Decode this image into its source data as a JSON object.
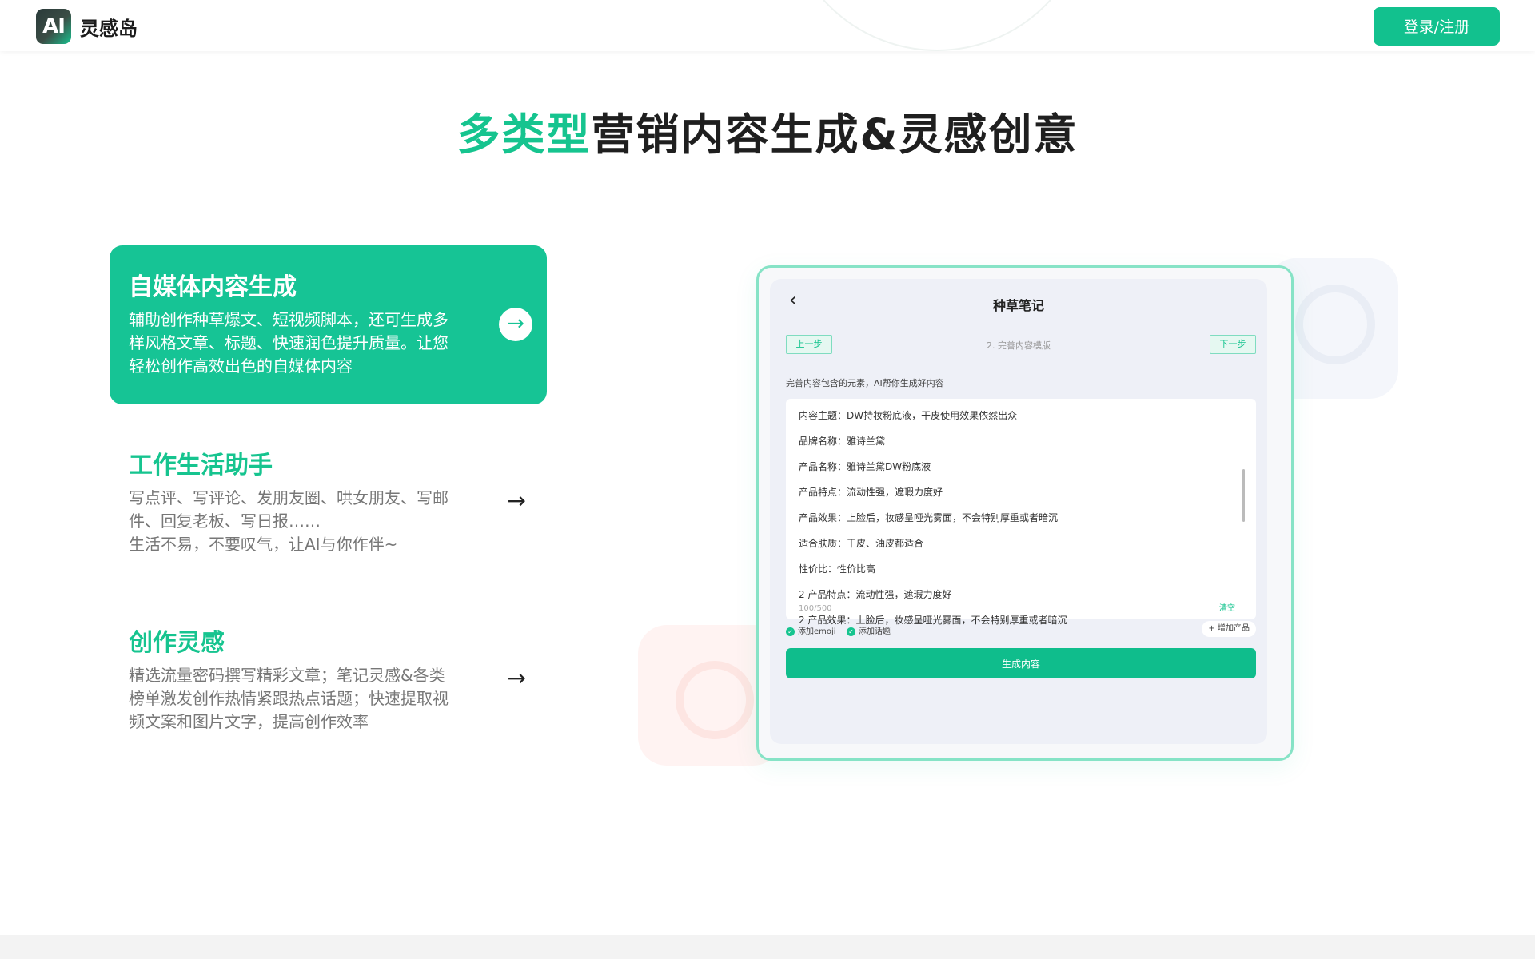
{
  "header": {
    "logo_text": "AI",
    "brand": "灵感岛",
    "login_label": "登录/注册"
  },
  "hero": {
    "title_highlight": "多类型",
    "title_rest": "营销内容生成&灵感创意"
  },
  "features": [
    {
      "title": "自媒体内容生成",
      "desc": "辅助创作种草爆文、短视频脚本，还可生成多\n样风格文章、标题、快速润色提升质量。让您\n轻松创作高效出色的自媒体内容",
      "active": true
    },
    {
      "title": "工作生活助手",
      "desc": "写点评、写评论、发朋友圈、哄女朋友、写邮\n件、回复老板、写日报……\n生活不易，不要叹气，让AI与你作伴~",
      "active": false
    },
    {
      "title": "创作灵感",
      "desc": "精选流量密码撰写精彩文章；笔记灵感&各类\n榜单激发创作热情紧跟热点话题；快速提取视\n频文案和图片文字，提高创作效率",
      "active": false
    }
  ],
  "icons": {
    "arrow": "→",
    "back": "‹",
    "check": "✓",
    "plus": "+"
  },
  "mock": {
    "screen_title": "种草笔记",
    "prev_step": "上一步",
    "current_step": "2. 完善内容模版",
    "next_step": "下一步",
    "hint": "完善内容包含的元素，AI帮你生成好内容",
    "lines": [
      "内容主题：DW持妆粉底液，干皮使用效果依然出众",
      "品牌名称：雅诗兰黛",
      "产品名称：雅诗兰黛DW粉底液",
      "产品特点：流动性强，遮瑕力度好",
      "产品效果：上脸后，妆感呈哑光雾面，不会特别厚重或者暗沉",
      "适合肤质：干皮、油皮都适合",
      "性价比：性价比高",
      "2 产品特点：流动性强，遮瑕力度好",
      "2 产品效果：上脸后，妆感呈哑光雾面，不会特别厚重或者暗沉"
    ],
    "counter": "100/500",
    "clear": "清空",
    "option_emoji": "添加emoji",
    "option_topic": "添加话题",
    "add_product": "增加产品",
    "generate": "生成内容"
  },
  "colors": {
    "accent": "#16c48f",
    "device_border": "#86e3c6"
  }
}
